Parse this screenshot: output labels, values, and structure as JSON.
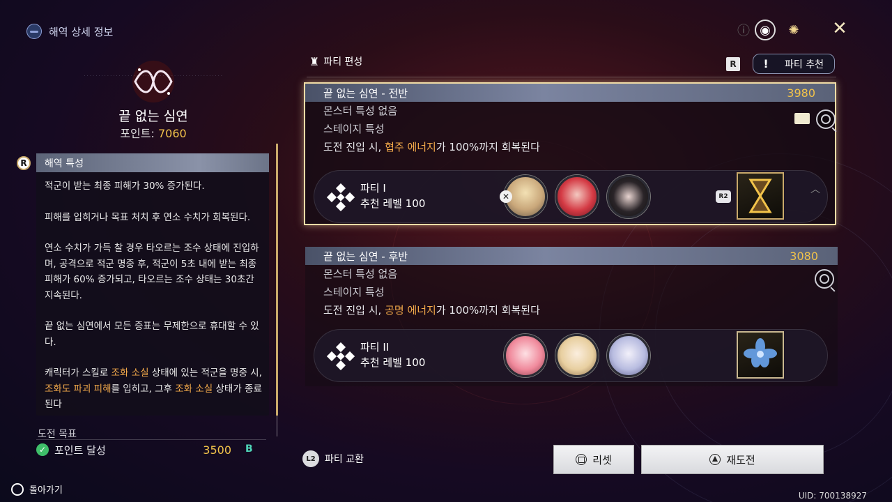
{
  "header": {
    "title": "해역 상세 정보"
  },
  "abyss": {
    "name": "끝 없는 심연",
    "points_label": "포인트:",
    "points_value": "7060"
  },
  "left_panel": {
    "header": "해역 특성",
    "badge": "R",
    "paragraphs": [
      "적군이 받는 최종 피해가 30% 증가된다.",
      "피해를 입히거나 목표 처치 후 연소 수치가 회복된다.",
      "연소 수치가 가득 찰 경우 타오르는 조수 상태에 진입하며, 공격으로 적군 명중 후, 적군이 5초 내에 받는 최종 피해가 60% 증가되고, 타오르는 조수 상태는 30초간 지속된다.",
      "끝 없는 심연에서 모든 증표는 무제한으로 휴대할 수 있다."
    ],
    "last_paragraph": {
      "p1": "캐릭터가 스킬로 ",
      "h1": "조화 소실",
      "p2": " 상태에 있는 적군을 명중 시, ",
      "h2": "조화도 파괴 피해",
      "p3": "를 입히고, 그후 ",
      "h3": "조화 소실",
      "p4": " 상태가 종료된다"
    }
  },
  "goal": {
    "label": "도전 목표",
    "item": "포인트 달성",
    "value": "3500",
    "b_icon": "B"
  },
  "back_label": "돌아가기",
  "party_edit": {
    "title": "파티 편성",
    "r_badge": "R",
    "recommend_icon": "!",
    "recommend_label": "파티 추천"
  },
  "stages": [
    {
      "title": "끝 없는 심연 - 전반",
      "points": "3980",
      "monster_trait": "몬스터 특성 없음",
      "stage_trait_label": "스테이지 특성",
      "desc_pre": "도전 진입 시, ",
      "desc_hl": "협주 에너지",
      "desc_post": "가 100%까지 회복된다",
      "party_name": "파티 I",
      "party_level": "추천 레벨 100",
      "r2_badge": "R2"
    },
    {
      "title": "끝 없는 심연 - 후반",
      "points": "3080",
      "monster_trait": "몬스터 특성 없음",
      "stage_trait_label": "스테이지 특성",
      "desc_pre": "도전 진입 시, ",
      "desc_hl": "공명 에너지",
      "desc_post": "가 100%까지 회복된다",
      "party_name": "파티 II",
      "party_level": "추천 레벨 100"
    }
  ],
  "bottom": {
    "l2_badge": "L2",
    "swap_label": "파티 교환",
    "reset_label": "리셋",
    "retry_label": "재도전"
  },
  "uid": "UID: 700138927",
  "colors": {
    "gold": "#f2c34a",
    "orange": "#f2a94a",
    "selected_border": "#f0dca6"
  },
  "icons": [
    "globe-icon",
    "emblem-icon",
    "info-icon",
    "target-icon",
    "sun-icon",
    "close-x-icon",
    "party-icon",
    "search-icon",
    "mail-icon",
    "remove-icon",
    "check-icon",
    "square-button-icon",
    "triangle-button-icon"
  ]
}
